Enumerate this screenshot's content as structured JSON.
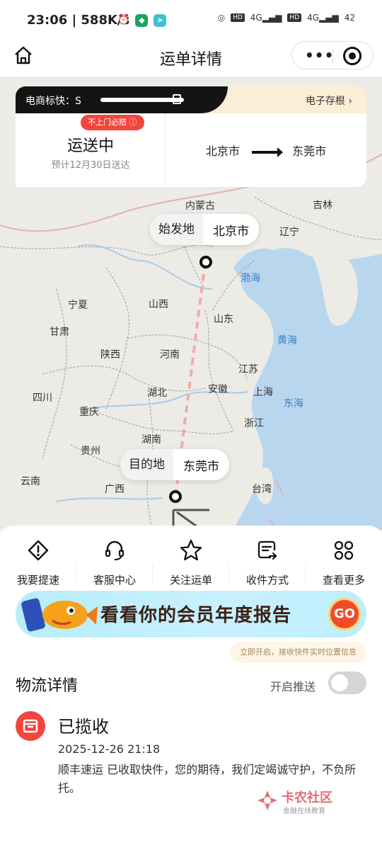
{
  "status_bar": {
    "time": "23:06",
    "speed": "588K/s",
    "signal1": "4G",
    "signal2": "4G",
    "battery": "42"
  },
  "nav": {
    "title": "运单详情"
  },
  "card": {
    "carrier_label": "电商标快：S",
    "stub_label": "电子存根 ›",
    "tag": "不上门必赔 ⓘ",
    "state": "运送中",
    "eta": "预计12月30日送达",
    "from_city": "北京市",
    "to_city": "东莞市"
  },
  "map": {
    "origin_key": "始发地",
    "origin_value": "北京市",
    "dest_key": "目的地",
    "dest_value": "东莞市",
    "regions": [
      "内蒙古",
      "吉林",
      "辽宁",
      "渤海",
      "宁夏",
      "山西",
      "山东",
      "甘肃",
      "黄海",
      "陕西",
      "河南",
      "江苏",
      "四川",
      "湖北",
      "安徽",
      "上海",
      "东海",
      "重庆",
      "浙江",
      "贵州",
      "湖南",
      "云南",
      "广西",
      "台湾"
    ]
  },
  "actions": [
    {
      "label": "我要提速",
      "icon": "speed-alert-icon"
    },
    {
      "label": "客服中心",
      "icon": "headset-icon"
    },
    {
      "label": "关注运单",
      "icon": "star-icon"
    },
    {
      "label": "收件方式",
      "icon": "receive-method-icon"
    },
    {
      "label": "查看更多",
      "icon": "more-grid-icon"
    }
  ],
  "banner": {
    "text": "看看你的会员年度报告",
    "go": "GO"
  },
  "tip": "立即开启，接收快件实时位置信息",
  "logistics": {
    "title": "物流详情",
    "push_label": "开启推送",
    "push_on": false,
    "event": {
      "status": "已揽收",
      "time": "2025-12-26 21:18",
      "desc": "顺丰速运 已收取快件，您的期待，我们定竭诚守护，不负所托。"
    }
  },
  "watermark": {
    "name": "卡农社区",
    "sub": "金融在线教育"
  },
  "colors": {
    "accent_red": "#f2453d",
    "route_dash": "#f4a9b0",
    "sea_label": "#3b7fc0"
  }
}
